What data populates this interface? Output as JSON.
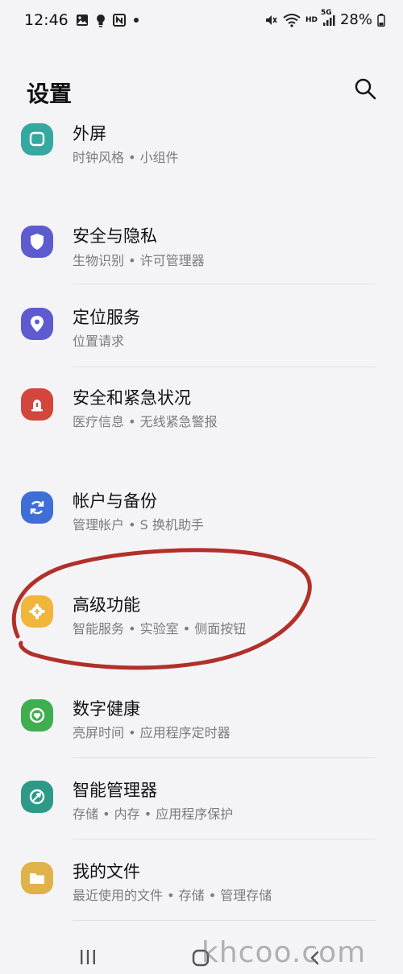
{
  "status_bar": {
    "time": "12:46",
    "battery": "28%",
    "left_icons": [
      "image-icon",
      "bulb-icon",
      "nfc-icon",
      "dot-icon"
    ],
    "right_icons": [
      "mute-icon",
      "wifi-icon",
      "hd-icon",
      "5g-signal-icon",
      "battery-icon"
    ],
    "hd_label": "HD",
    "fiveg_label": "5G"
  },
  "header": {
    "title": "设置"
  },
  "items": [
    {
      "id": "cover-screen",
      "title": "外屏",
      "subtitle": "时钟风格 • 小组件",
      "icon": "cover-screen-icon",
      "color": "#35a8a0"
    },
    {
      "id": "security-privacy",
      "title": "安全与隐私",
      "subtitle": "生物识别 • 许可管理器",
      "icon": "shield-icon",
      "color": "#5e5bd0"
    },
    {
      "id": "location",
      "title": "定位服务",
      "subtitle": "位置请求",
      "icon": "location-pin-icon",
      "color": "#5e5bd0"
    },
    {
      "id": "safety-emergency",
      "title": "安全和紧急状况",
      "subtitle": "医疗信息 • 无线紧急警报",
      "icon": "emergency-icon",
      "color": "#d4453c"
    },
    {
      "id": "accounts-backup",
      "title": "帐户与备份",
      "subtitle": "管理帐户 • S 换机助手",
      "icon": "sync-icon",
      "color": "#3f6fd6"
    },
    {
      "id": "advanced-features",
      "title": "高级功能",
      "subtitle": "智能服务 • 实验室 • 侧面按钮",
      "icon": "puzzle-gear-icon",
      "color": "#f0b53a"
    },
    {
      "id": "digital-wellbeing",
      "title": "数字健康",
      "subtitle": "亮屏时间 • 应用程序定时器",
      "icon": "wellbeing-icon",
      "color": "#3fae4e"
    },
    {
      "id": "device-care",
      "title": "智能管理器",
      "subtitle": "存储 • 内存 • 应用程序保护",
      "icon": "device-care-icon",
      "color": "#2c9a86"
    },
    {
      "id": "my-files",
      "title": "我的文件",
      "subtitle": "最近使用的文件 • 存储 • 管理存储",
      "icon": "folder-icon",
      "color": "#e0b24a"
    }
  ],
  "annotation": {
    "color": "#b2302a",
    "target": "advanced-features"
  },
  "watermark": "khcoo.com",
  "nav": [
    "recents-button",
    "home-button",
    "back-button"
  ]
}
